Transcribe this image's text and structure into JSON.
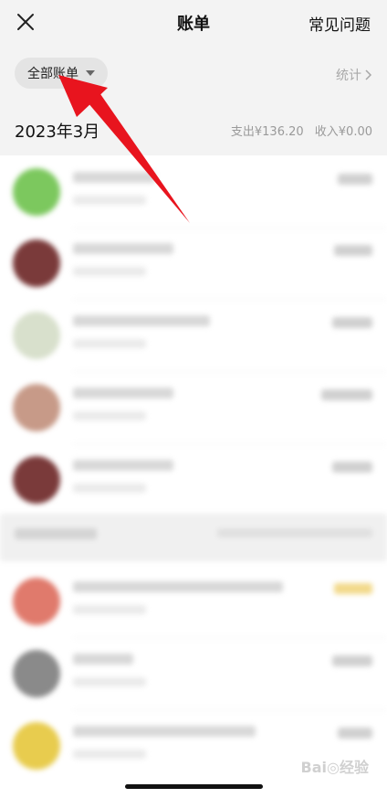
{
  "header": {
    "close_icon": "close-icon",
    "title": "账单",
    "faq": "常见问题"
  },
  "filter": {
    "label": "全部账单",
    "stats": "统计"
  },
  "summary": {
    "month": "2023年3月",
    "expense": "支出¥136.20",
    "income": "收入¥0.00"
  },
  "colors": {
    "background": "#f3f3f3",
    "annotation_arrow": "#e8141e"
  }
}
